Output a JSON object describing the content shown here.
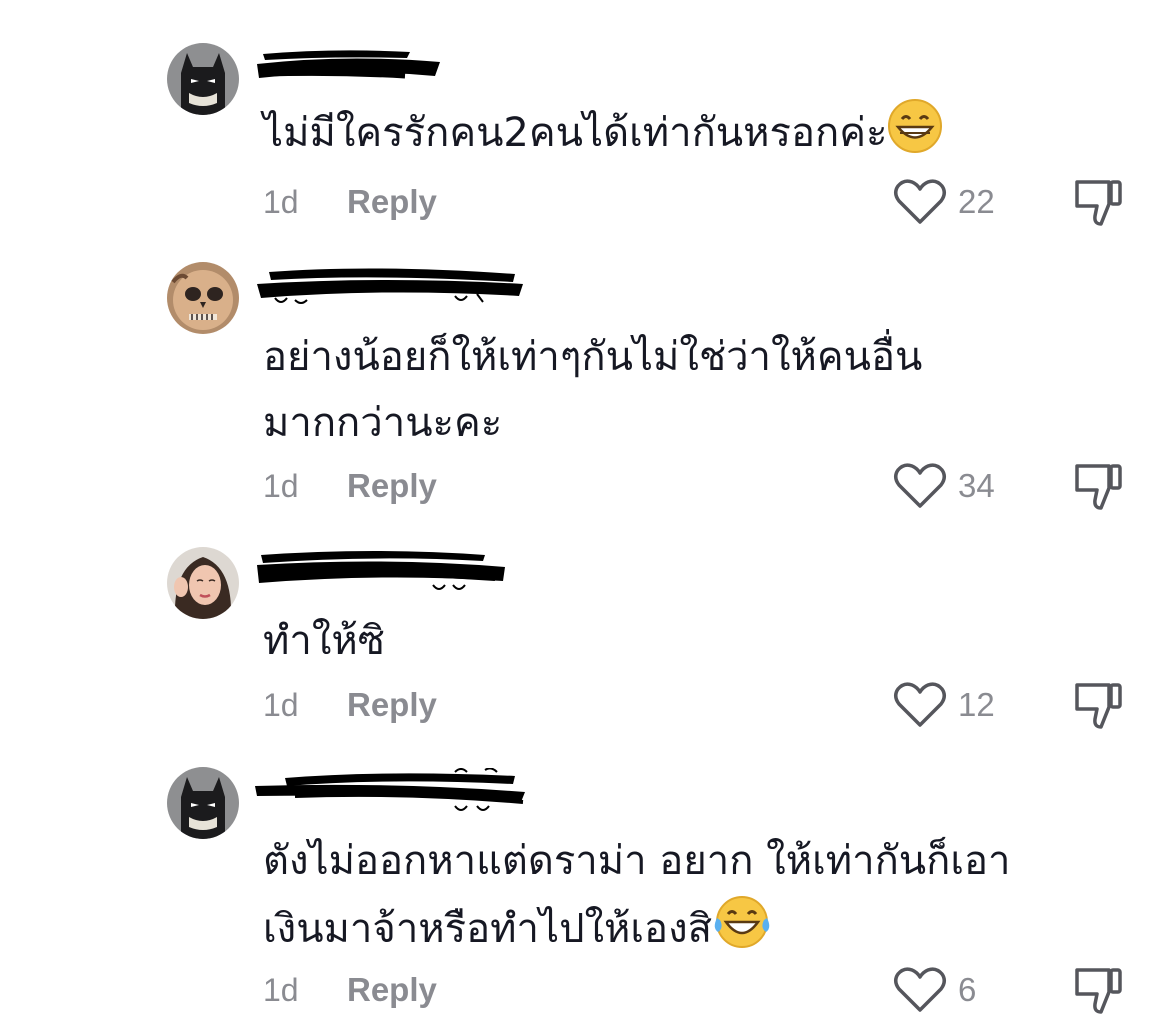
{
  "comments": [
    {
      "text_line1": "ไม่มีใครรักคน2คนได้เท่ากันหรอกค่ะ",
      "emoji": "grinning-face-icon",
      "time": "1d",
      "reply_label": "Reply",
      "likes": "22"
    },
    {
      "text_line1": "อย่างน้อยก็ให้เท่าๆกันไม่ใช่ว่าให้คนอื่น",
      "text_line2": "มากกว่านะคะ",
      "time": "1d",
      "reply_label": "Reply",
      "likes": "34"
    },
    {
      "text_line1": "ทำให้ซิ",
      "time": "1d",
      "reply_label": "Reply",
      "likes": "12"
    },
    {
      "text_line1": "ตังไม่ออกหาแต่ดราม่า อยาก ให้เท่ากันก็เอา",
      "text_line2": "เงินมาจ้าหรือทำไปให้เองสิ",
      "emoji": "tears-of-joy-icon",
      "time": "1d",
      "reply_label": "Reply",
      "likes": "6"
    }
  ],
  "colors": {
    "text": "#161823",
    "muted": "#8a8b91",
    "redaction": "#000000"
  }
}
